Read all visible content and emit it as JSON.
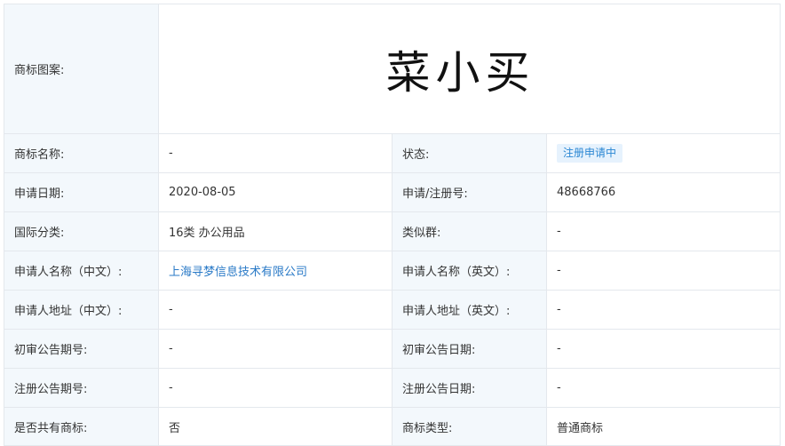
{
  "trademark": {
    "image": {
      "label": "商标图案:",
      "text": "菜小买"
    },
    "name": {
      "label": "商标名称:",
      "value": "-"
    },
    "status": {
      "label": "状态:",
      "value": "注册申请中",
      "badge_bg": "#e6f2fd",
      "badge_color": "#2a87d3"
    },
    "apply_date": {
      "label": "申请日期:",
      "value": "2020-08-05"
    },
    "reg_no": {
      "label": "申请/注册号:",
      "value": "48668766"
    },
    "intl_class": {
      "label": "国际分类:",
      "value": "16类 办公用品"
    },
    "similar_group": {
      "label": "类似群:",
      "value": "-"
    },
    "applicant_cn": {
      "label": "申请人名称（中文）:",
      "value": "上海寻梦信息技术有限公司",
      "link_color": "#2a7ac7"
    },
    "applicant_en": {
      "label": "申请人名称（英文）:",
      "value": "-"
    },
    "address_cn": {
      "label": "申请人地址（中文）:",
      "value": "-"
    },
    "address_en": {
      "label": "申请人地址（英文）:",
      "value": "-"
    },
    "prelim_no": {
      "label": "初审公告期号:",
      "value": "-"
    },
    "prelim_date": {
      "label": "初审公告日期:",
      "value": "-"
    },
    "reg_pub_no": {
      "label": "注册公告期号:",
      "value": "-"
    },
    "reg_pub_date": {
      "label": "注册公告日期:",
      "value": "-"
    },
    "shared": {
      "label": "是否共有商标:",
      "value": "否"
    },
    "type": {
      "label": "商标类型:",
      "value": "普通商标"
    }
  },
  "colors": {
    "label_bg": "#f3f8fc",
    "border": "#e4e8ed",
    "text": "#333333"
  }
}
